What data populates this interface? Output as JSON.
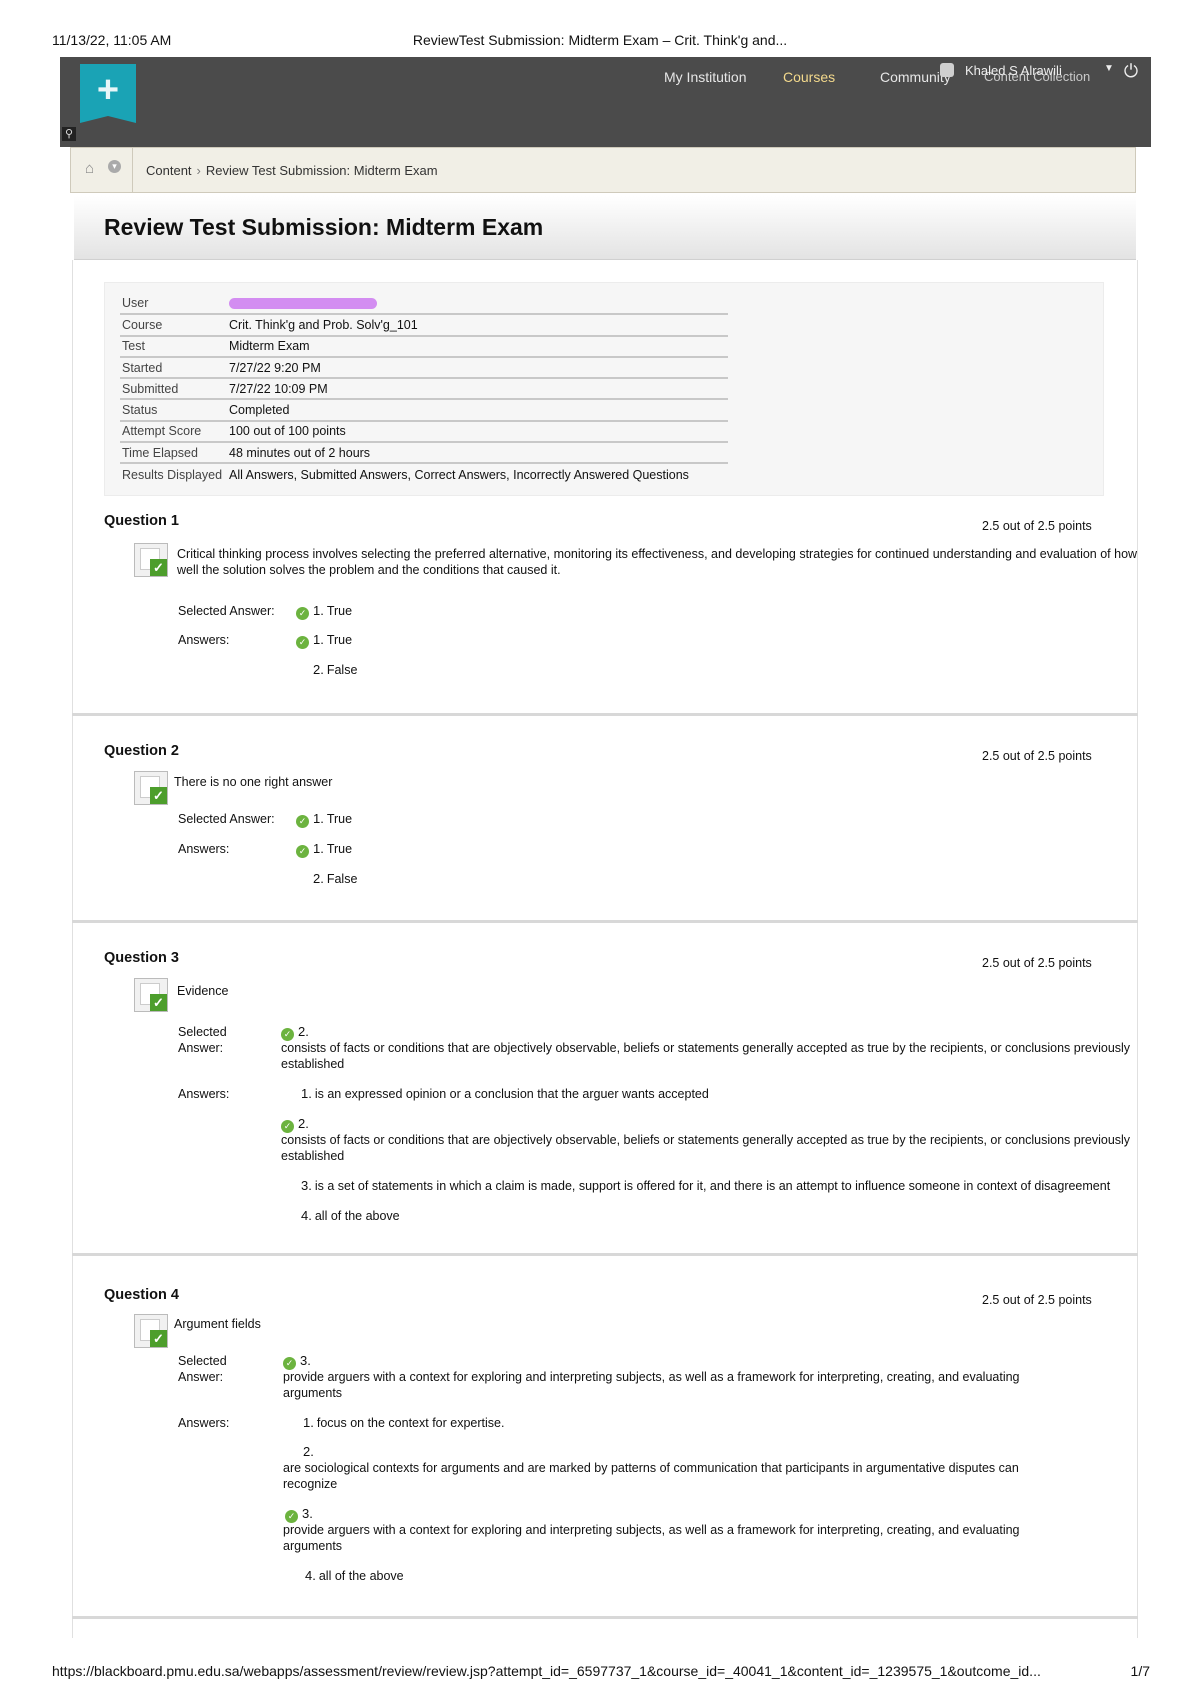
{
  "print_header": {
    "datetime": "11/13/22, 11:05 AM",
    "title": "ReviewTest Submission: Midterm Exam – Crit. Think'g and..."
  },
  "topbar": {
    "nav": [
      "My Institution",
      "Courses",
      "Community",
      "Content Collection"
    ],
    "active_nav": "Courses",
    "user_name": "Khaled S Alrawili",
    "logo_icon": "plus-icon",
    "power_icon": "power-icon"
  },
  "breadcrumb": {
    "items": [
      "Content",
      "Review Test Submission: Midterm Exam"
    ]
  },
  "page_title": "Review Test Submission: Midterm Exam",
  "summary": {
    "rows": [
      {
        "label": "User",
        "value": ""
      },
      {
        "label": "Course",
        "value": "Crit. Think'g and Prob. Solv'g_101"
      },
      {
        "label": "Test",
        "value": "Midterm Exam"
      },
      {
        "label": "Started",
        "value": "7/27/22 9:20 PM"
      },
      {
        "label": "Submitted",
        "value": "7/27/22 10:09 PM"
      },
      {
        "label": "Status",
        "value": "Completed"
      },
      {
        "label": "Attempt Score",
        "value": "100 out of 100 points"
      },
      {
        "label": "Time Elapsed",
        "value": "48 minutes out of 2 hours"
      },
      {
        "label": "Results Displayed",
        "value": "All Answers, Submitted Answers, Correct Answers, Incorrectly Answered Questions"
      }
    ]
  },
  "labels": {
    "selected_answer": "Selected Answer:",
    "selected": "Selected",
    "answer": "Answer:",
    "answers": "Answers:"
  },
  "questions": [
    {
      "title": "Question 1",
      "points": "2.5 out of 2.5 points",
      "text_line1": "Critical thinking process involves selecting the preferred alternative, monitoring its effectiveness, and developing strategies for continued understanding and evaluation of how",
      "text_line2": "well the solution solves the problem and the conditions that caused it.",
      "selected_num": "1.",
      "selected_text": "True",
      "answers": [
        {
          "num": "1.",
          "text": "True",
          "correct": true
        },
        {
          "num": "2.",
          "text": "False",
          "correct": false
        }
      ]
    },
    {
      "title": "Question 2",
      "points": "2.5 out of 2.5 points",
      "text_line1": "There is no one right answer",
      "selected_num": "1.",
      "selected_text": "True",
      "answers": [
        {
          "num": "1.",
          "text": "True",
          "correct": true
        },
        {
          "num": "2.",
          "text": "False",
          "correct": false
        }
      ]
    },
    {
      "title": "Question 3",
      "points": "2.5 out of 2.5 points",
      "text_line1": "Evidence",
      "selected_num": "2.",
      "selected_text_line1": "consists of facts or conditions that are objectively observable, beliefs or statements generally accepted as true by the recipients, or conclusions previously",
      "selected_text_line2": "established",
      "answers": [
        {
          "num": "1.",
          "text": "is an expressed opinion or a conclusion that the arguer wants accepted",
          "correct": false
        },
        {
          "num": "2.",
          "text": "consists of facts or conditions that are objectively observable, beliefs or statements generally accepted as true by the recipients, or conclusions previously",
          "text2": "established",
          "correct": true
        },
        {
          "num": "3.",
          "text": "is a set of statements in which a claim is made, support is offered for it, and there is an attempt to influence someone in context of disagreement",
          "correct": false
        },
        {
          "num": "4.",
          "text": "all of the above",
          "correct": false
        }
      ]
    },
    {
      "title": "Question 4",
      "points": "2.5 out of 2.5 points",
      "text_line1": "Argument fields",
      "selected_num": "3.",
      "selected_text_line1": "provide arguers with a context for exploring and interpreting subjects, as well as a framework for interpreting, creating, and evaluating",
      "selected_text_line2": "arguments",
      "answers": [
        {
          "num": "1.",
          "text": "focus on the context for expertise.",
          "correct": false
        },
        {
          "num": "2.",
          "text": "are sociological contexts for arguments and are marked by patterns of communication that participants in argumentative disputes can",
          "text2": "recognize",
          "correct": false
        },
        {
          "num": "3.",
          "text": "provide arguers with a context for exploring and interpreting subjects, as well as a framework for interpreting, creating, and evaluating",
          "text2": "arguments",
          "correct": true
        },
        {
          "num": "4.",
          "text": "all of the above",
          "correct": false
        }
      ]
    }
  ],
  "print_footer": {
    "url": "https://blackboard.pmu.edu.sa/webapps/assessment/review/review.jsp?attempt_id=_6597737_1&course_id=_40041_1&content_id=_1239575_1&outcome_id...",
    "page": "1/7"
  }
}
